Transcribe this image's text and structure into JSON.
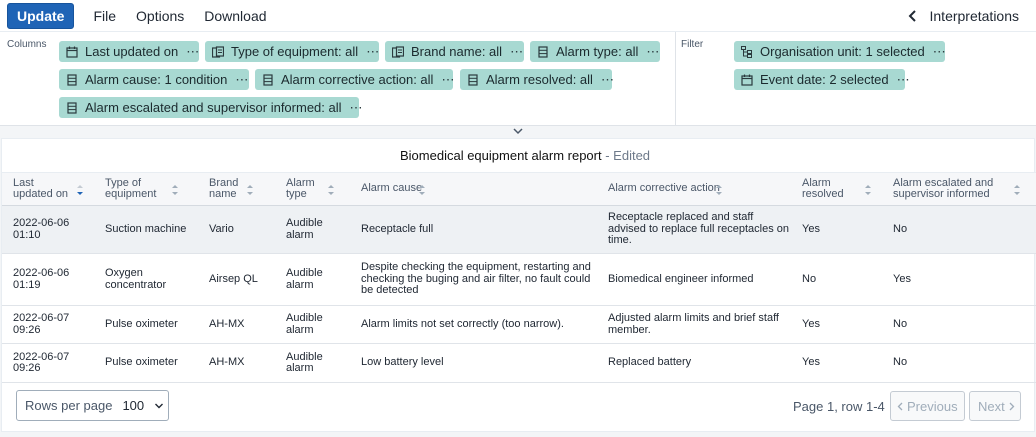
{
  "topbar": {
    "update_label": "Update",
    "menu": [
      "File",
      "Options",
      "Download"
    ],
    "interpretations_label": "Interpretations"
  },
  "layout": {
    "columns_label": "Columns",
    "filter_label": "Filter",
    "column_chips": [
      {
        "label": "Last updated on",
        "icon": "calendar-icon"
      },
      {
        "label": "Type of equipment: all",
        "icon": "option-set-icon"
      },
      {
        "label": "Brand name: all",
        "icon": "option-set-icon"
      },
      {
        "label": "Alarm type: all",
        "icon": "data-element-icon"
      },
      {
        "label": "Alarm cause: 1 condition",
        "icon": "data-element-icon"
      },
      {
        "label": "Alarm corrective action: all",
        "icon": "data-element-icon"
      },
      {
        "label": "Alarm resolved: all",
        "icon": "data-element-icon"
      },
      {
        "label": "Alarm escalated and supervisor informed: all",
        "icon": "data-element-icon"
      }
    ],
    "filter_chips": [
      {
        "label": "Organisation unit: 1 selected",
        "icon": "org-unit-icon"
      },
      {
        "label": "Event date: 2 selected",
        "icon": "calendar-icon"
      }
    ],
    "chip_menu": "⋯"
  },
  "report": {
    "title": "Biomedical equipment alarm report",
    "edited": " - Edited"
  },
  "table": {
    "headers": [
      "Last updated on",
      "Type of equipment",
      "Brand name",
      "Alarm type",
      "Alarm cause",
      "Alarm corrective action",
      "Alarm resolved",
      "Alarm escalated and supervisor informed"
    ],
    "rows": [
      [
        "2022-06-06 01:10",
        "Suction machine",
        "Vario",
        "Audible alarm",
        "Receptacle full",
        "Receptacle replaced and staff advised to replace full receptacles on time.",
        "Yes",
        "No"
      ],
      [
        "2022-06-06 01:19",
        "Oxygen concentrator",
        "Airsep QL",
        "Audible alarm",
        "Despite checking the equipment, restarting and checking the buging and air filter, no fault could be detected",
        "Biomedical engineer informed",
        "No",
        "Yes"
      ],
      [
        "2022-06-07 09:26",
        "Pulse oximeter",
        "AH-MX",
        "Audible alarm",
        "Alarm limits not set correctly (too narrow).",
        "Adjusted alarm limits and brief staff member.",
        "Yes",
        "No"
      ],
      [
        "2022-06-07 09:26",
        "Pulse oximeter",
        "AH-MX",
        "Audible alarm",
        "Low battery level",
        "Replaced battery",
        "Yes",
        "No"
      ]
    ]
  },
  "footer": {
    "rows_per_page_label": "Rows per page",
    "rows_per_page_value": "100",
    "page_info": "Page 1, row 1-4",
    "prev_label": "Previous",
    "next_label": "Next"
  },
  "colors": {
    "accent": "#1f64b6",
    "chip": "#a8d9d2"
  }
}
